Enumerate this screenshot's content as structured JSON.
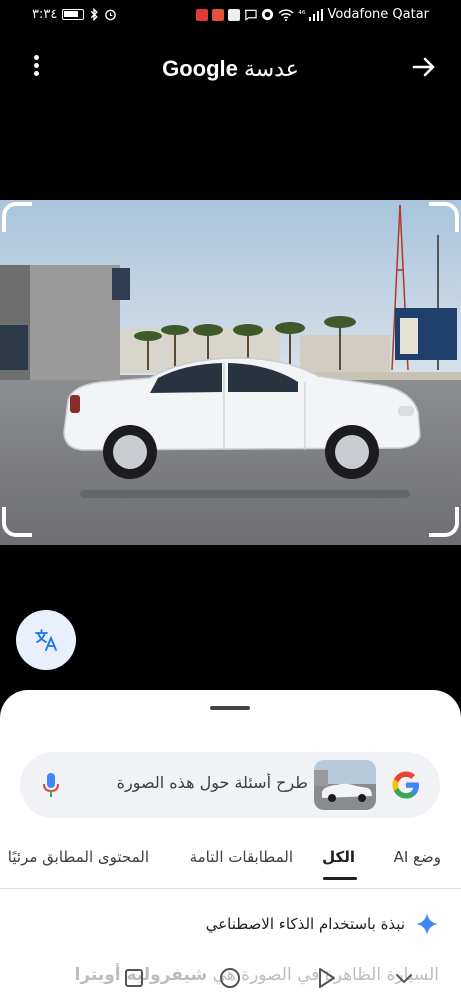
{
  "status_bar": {
    "time": "٣:٣٤",
    "network": "⁴⁶",
    "carrier": "Vodafone Qatar"
  },
  "header": {
    "title_brand": "Google",
    "title_suffix": "عدسة",
    "menu_icon": "more-vert-icon",
    "forward_icon": "arrow-forward-icon"
  },
  "search": {
    "placeholder": "طرح أسئلة حول هذه الصورة",
    "mic_icon": "mic-icon",
    "logo_icon": "google-g-icon"
  },
  "tabs": [
    {
      "label": "وضع AI",
      "active": false
    },
    {
      "label": "الكل",
      "active": true
    },
    {
      "label": "المطابقات التامة",
      "active": false
    },
    {
      "label": "المحتوى المطابق مرئيًا",
      "active": false
    }
  ],
  "ai_overview": {
    "title": "نبذة باستخدام الذكاء الاصطناعي",
    "snippet_prefix": "السيارة الظاهرة في الصورة هي",
    "snippet_bold": "شيفروليه أوبترا",
    "sparkle_color": "#4285f4"
  },
  "nav": {
    "back": "back-icon",
    "home": "home-icon",
    "recents": "recents-icon",
    "collapse": "chevron-down-icon"
  }
}
